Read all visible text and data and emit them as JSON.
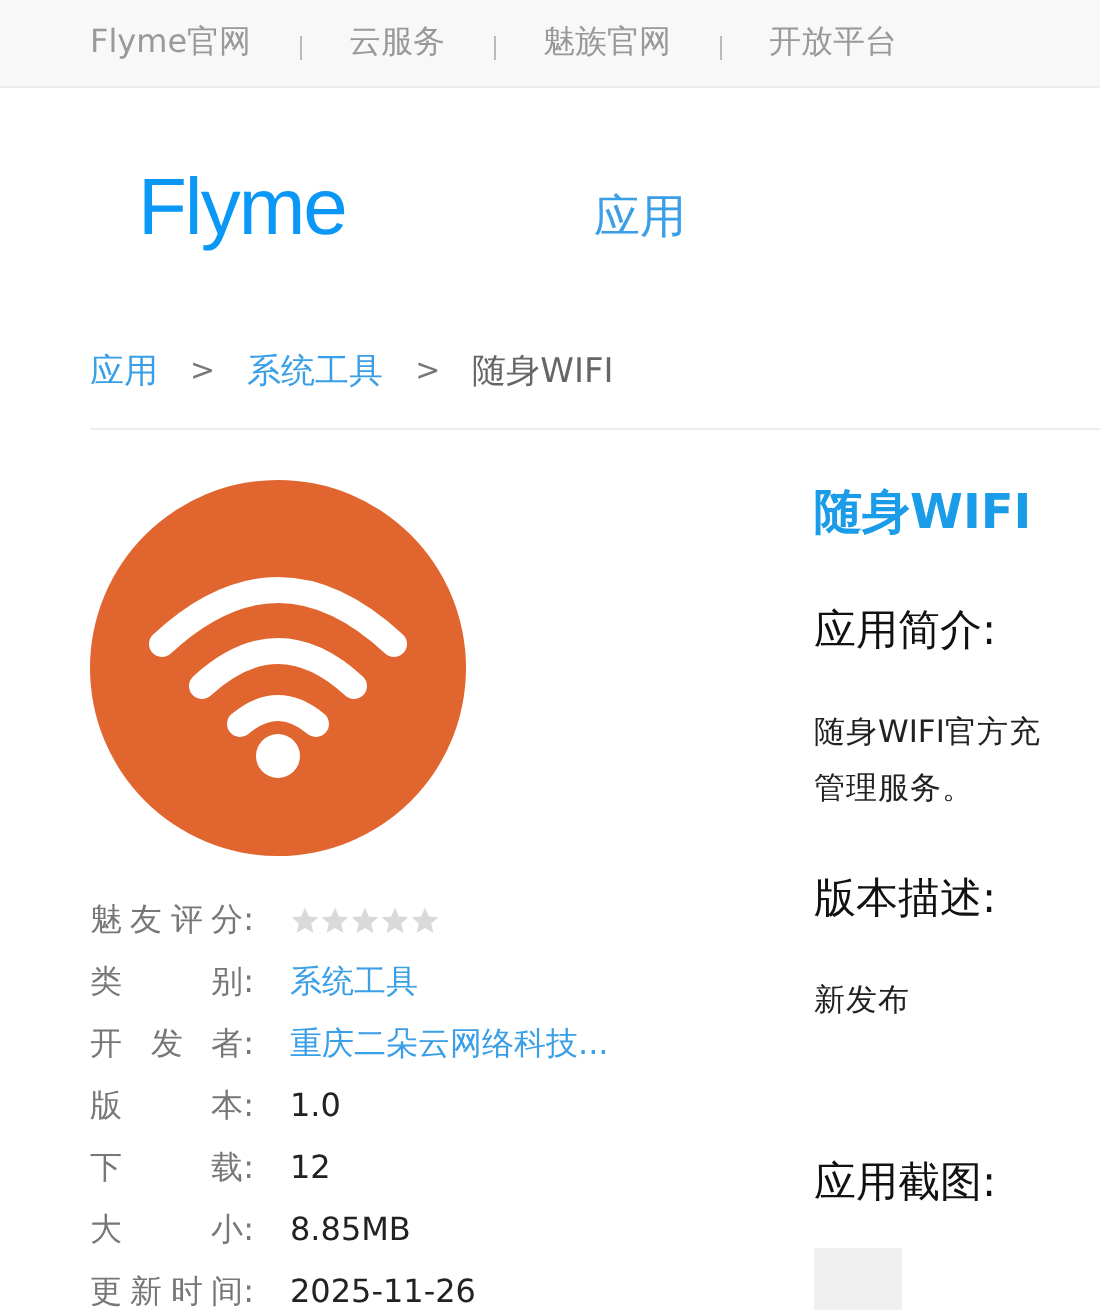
{
  "top_links": [
    "Flyme官网",
    "云服务",
    "魅族官网",
    "开放平台"
  ],
  "header": {
    "logo": "Flyme",
    "nav": [
      {
        "label": "应用",
        "selected": true
      }
    ]
  },
  "breadcrumb": [
    {
      "label": "应用",
      "kind": "link"
    },
    {
      "label": ">",
      "kind": "separator"
    },
    {
      "label": "系统工具",
      "kind": "link"
    },
    {
      "label": ">",
      "kind": "separator"
    },
    {
      "label": "随身WIFI",
      "kind": "current"
    }
  ],
  "app": {
    "name": "随身WIFI",
    "stars": 0,
    "info": [
      {
        "label": "魅友评分:",
        "kind": "stars"
      },
      {
        "label": "类别:",
        "value": "系统工具",
        "kind": "link"
      },
      {
        "label": "开发者:",
        "value": "重庆二朵云网络科技...",
        "kind": "link"
      },
      {
        "label": "版本:",
        "value": "1.0",
        "kind": "text"
      },
      {
        "label": "下载:",
        "value": "12",
        "kind": "text"
      },
      {
        "label": "大小:",
        "value": "8.85MB",
        "kind": "text"
      },
      {
        "label": "更新时间:",
        "value": "2025-11-26",
        "kind": "text"
      }
    ],
    "sections": [
      {
        "heading": "应用简介:",
        "lines": [
          "随身WIFI官方充",
          "管理服务。"
        ]
      },
      {
        "heading": "版本描述:",
        "lines": [
          "新发布"
        ]
      },
      {
        "heading": "应用截图:",
        "kind": "screenshots"
      }
    ]
  }
}
